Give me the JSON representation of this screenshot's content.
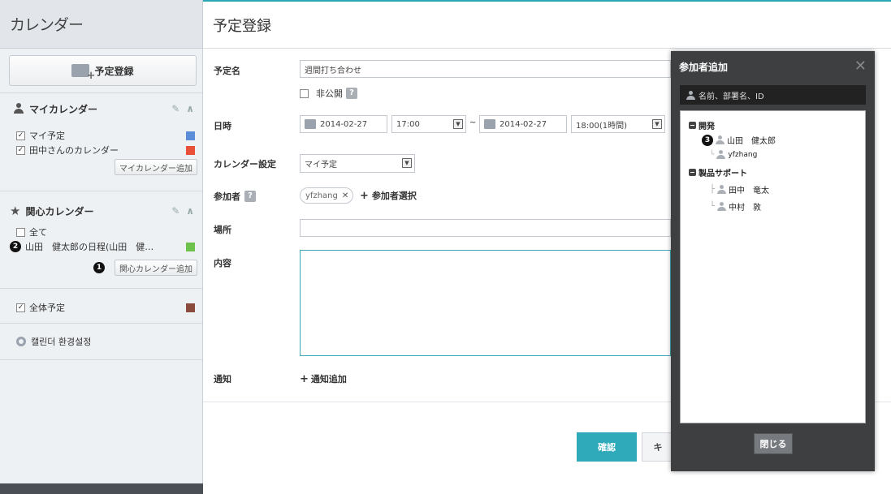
{
  "sidebar": {
    "title": "カレンダー",
    "register_button": "予定登録",
    "my_calendar": {
      "title": "マイカレンダー",
      "items": [
        {
          "label": "マイ予定",
          "checked": true,
          "color": "#5b8dd9"
        },
        {
          "label": "田中さんのカレンダー",
          "checked": true,
          "color": "#e8503a"
        }
      ],
      "add_button": "マイカレンダー追加"
    },
    "interest_calendar": {
      "title": "関心カレンダー",
      "items": [
        {
          "label": "全て",
          "checked": false
        },
        {
          "label": "山田　健太郎の日程(山田　健…",
          "color": "#6cc24a",
          "badge": "2"
        }
      ],
      "add_button": "関心カレンダー追加",
      "add_badge": "1"
    },
    "all_schedule": {
      "label": "全体予定",
      "checked": true,
      "color": "#8a4b3c"
    },
    "settings_label": "캘린더 환경설정"
  },
  "main": {
    "title": "予定登録",
    "labels": {
      "name": "予定名",
      "datetime": "日時",
      "calendar": "カレンダー設定",
      "participants": "参加者",
      "place": "場所",
      "content": "内容",
      "notify": "通知"
    },
    "name_value": "週間打ち合わせ",
    "private_label": "非公開",
    "help_icon": "?",
    "start_date": "2014-02-27",
    "start_time": "17:00",
    "tilde": "~",
    "end_date": "2014-02-27",
    "end_time": "18:00(1時間)",
    "calendar_value": "マイ予定",
    "participant_chip": "yfzhang",
    "participant_select": "参加者選択",
    "notify_add": "通知追加",
    "confirm_button": "確認",
    "cancel_button": "キ"
  },
  "modal": {
    "title": "参加者追加",
    "search_placeholder": "名前、部署名、ID",
    "tree": {
      "group1": "開発",
      "g1_user1": "山田　健太郎",
      "g1_user1_badge": "3",
      "g1_user2": "yfzhang",
      "group2": "製品サポート",
      "g2_user1": "田中　竜太",
      "g2_user2": "中村　敦"
    },
    "close_button": "閉じる"
  },
  "colors": {
    "accent": "#2eaabb"
  }
}
